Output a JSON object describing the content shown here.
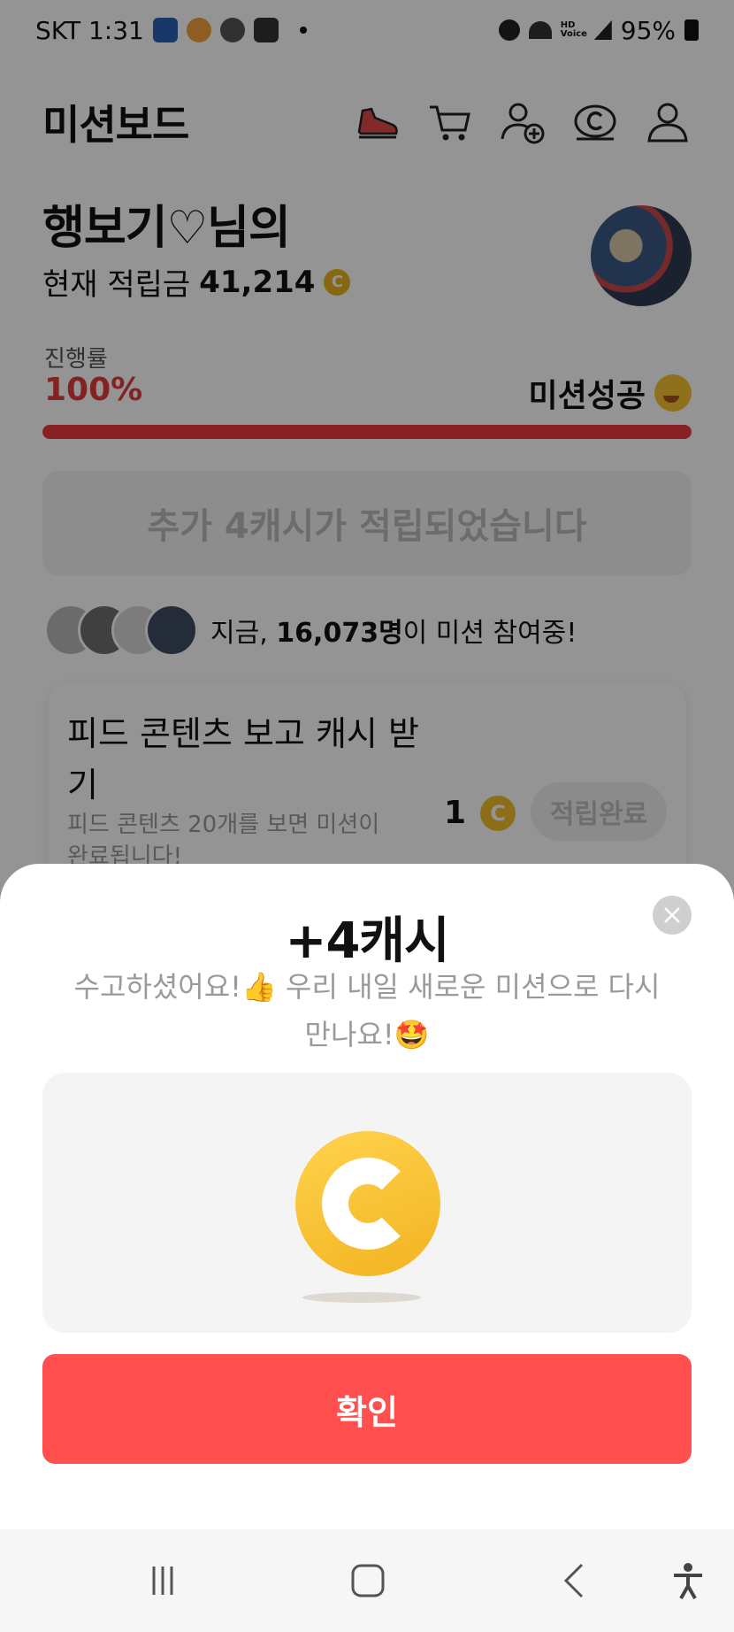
{
  "status_bar": {
    "carrier_time": "SKT 1:31",
    "hd_voice": "HD Voice",
    "battery": "95%"
  },
  "header": {
    "title": "미션보드",
    "icons": [
      "shoe-icon",
      "cart-icon",
      "add-user-icon",
      "cash-coin-icon",
      "profile-icon"
    ]
  },
  "profile": {
    "user_name": "행보기♡님의",
    "balance_label": "현재 적립금",
    "balance_value": "41,214",
    "coin_glyph": "C"
  },
  "progress": {
    "label": "진행률",
    "value": "100%",
    "fraction": 1.0,
    "status": "미션성공"
  },
  "banner": {
    "text": "추가 4캐시가 적립되었습니다"
  },
  "participants": {
    "prefix": "지금,",
    "count": "16,073명",
    "suffix": "이 미션 참여중!"
  },
  "feed_card": {
    "title": "피드 콘텐츠 보고 캐시 받기",
    "description": "피드 콘텐츠 20개를 보면 미션이 완료됩니다!",
    "reward": "1",
    "button": "적립완료"
  },
  "sheet": {
    "title": "+4캐시",
    "message_line1": "수고하셨어요!👍 우리 내일 새로운 미션으로 다시",
    "message_line2": "만나요!🤩",
    "confirm_label": "확인"
  },
  "colors": {
    "accent_red": "#ff4f4f",
    "progress_red": "#e8393f",
    "coin_gold": "#f2bd2c"
  }
}
